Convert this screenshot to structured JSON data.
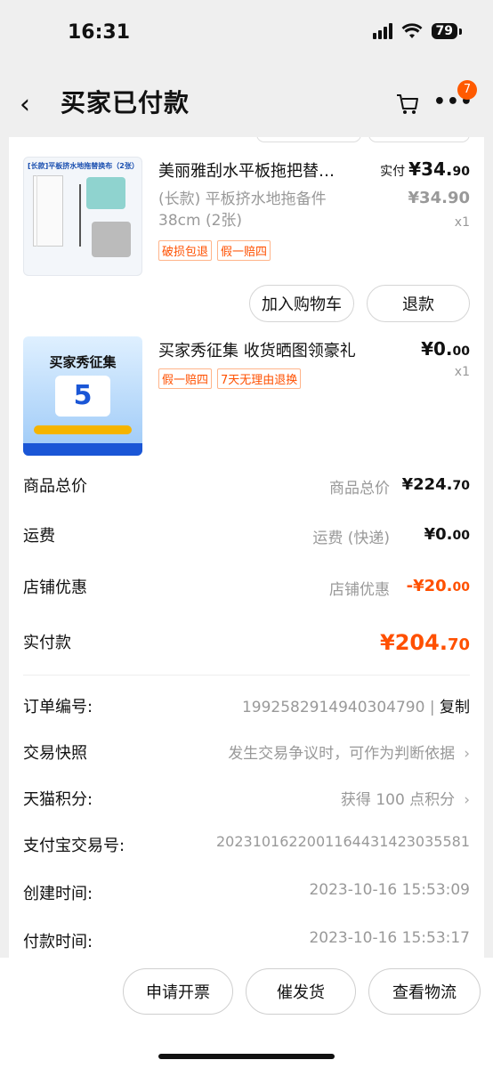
{
  "status_bar": {
    "time": "16:31",
    "battery": "79"
  },
  "nav": {
    "title": "买家已付款",
    "badge_count": "7"
  },
  "products": [
    {
      "title": "美丽雅刮水平板拖把替…",
      "subtitle": "(长款) 平板挤水地拖备件 38cm (2张)",
      "tags": [
        "破损包退",
        "假一赔四"
      ],
      "price_label": "实付",
      "price_main_int": "¥34.",
      "price_main_cents": "90",
      "price_orig": "¥34.90",
      "qty": "x1",
      "buttons": [
        "加入购物车",
        "退款"
      ],
      "image_caption": "[长款]平板挤水地拖替换布（2张）"
    },
    {
      "title": "买家秀征集 收货晒图领豪礼",
      "tags": [
        "假一赔四",
        "7天无理由退换"
      ],
      "price_main_int": "¥0.",
      "price_main_cents": "00",
      "qty": "x1",
      "image_title": "买家秀征集",
      "image_amount": "5"
    }
  ],
  "summary": [
    {
      "label": "商品总价",
      "mid": "商品总价",
      "value_int": "¥224.",
      "value_cents": "70"
    },
    {
      "label": "运费",
      "mid": "运费 (快递)",
      "value_int": "¥0.",
      "value_cents": "00"
    },
    {
      "label": "店铺优惠",
      "mid": "店铺优惠",
      "value_int": "-¥20.",
      "value_cents": "00"
    }
  ],
  "paid": {
    "label": "实付款",
    "value_int": "¥204.",
    "value_cents": "70"
  },
  "info": {
    "order_no_label": "订单编号:",
    "order_no": "1992582914940304790",
    "copy": "复制",
    "snapshot_label": "交易快照",
    "snapshot_value": "发生交易争议时，可作为判断依据",
    "points_label": "天猫积分:",
    "points_value": "获得 100 点积分",
    "alipay_label": "支付宝交易号:",
    "alipay_value": "2023101622001164431423035581",
    "created_label": "创建时间:",
    "created_value": "2023-10-16 15:53:09",
    "paid_label": "付款时间:",
    "paid_value": "2023-10-16 15:53:17"
  },
  "bottom_buttons": [
    "申请开票",
    "催发货",
    "查看物流"
  ],
  "colors": {
    "accent": "#ff5000",
    "badge": "#ff5a00"
  }
}
